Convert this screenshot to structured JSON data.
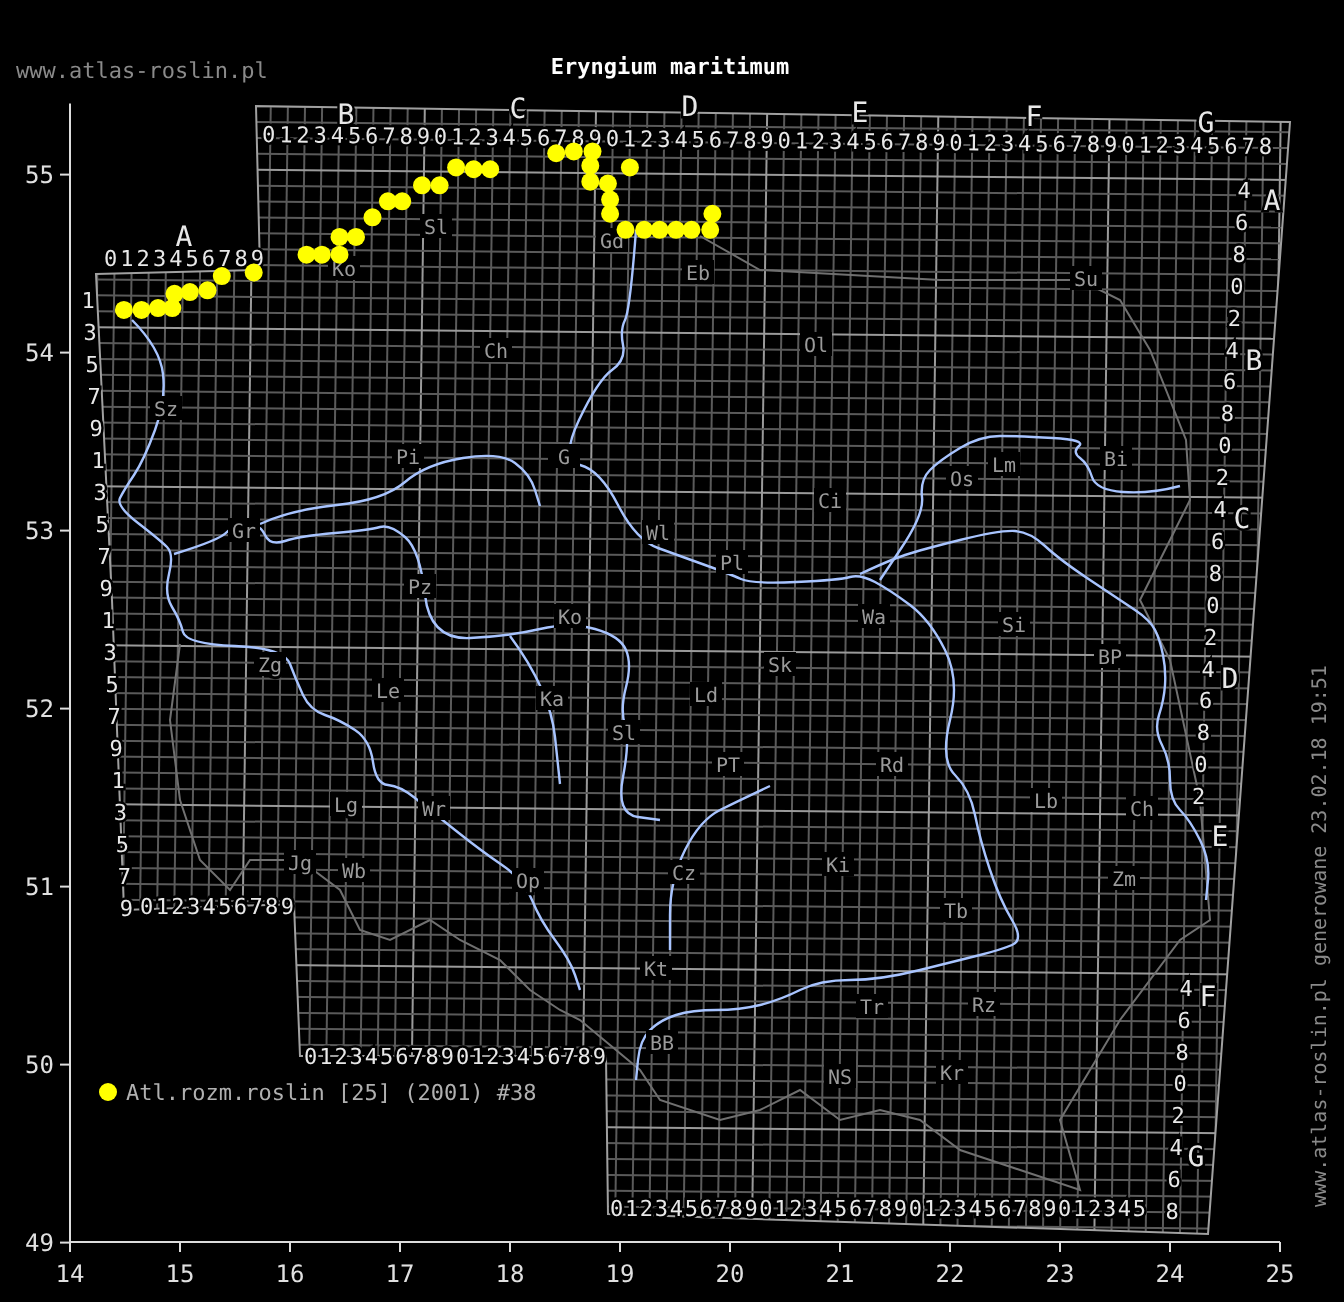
{
  "header": {
    "site": "www.atlas-roslin.pl",
    "title": "Eryngium maritimum"
  },
  "map": {
    "column_letters": [
      "A",
      "B",
      "C",
      "D",
      "E",
      "F",
      "G"
    ],
    "column_digits": [
      "0123456789",
      "01234567890123456789012345678901234567890123456789012345678",
      "0123456789",
      "01234567890123456789",
      "012345678901234567890123456789012345"
    ],
    "left_digits": [
      "1",
      "3",
      "5",
      "7",
      "9",
      "1",
      "3",
      "5",
      "7",
      "9",
      "1",
      "3",
      "5",
      "7",
      "9",
      "1",
      "3",
      "5",
      "7",
      "9"
    ],
    "right_digits": [
      "4",
      "6",
      "8",
      "0",
      "2",
      "4",
      "6",
      "8",
      "0",
      "2",
      "4",
      "6",
      "8",
      "0",
      "2",
      "4",
      "6",
      "8",
      "0",
      "2",
      "4",
      "6",
      "8",
      "0",
      "2",
      "4",
      "6",
      "8"
    ],
    "row_letters": [
      "A",
      "B",
      "C",
      "D",
      "E",
      "F",
      "G"
    ],
    "region_labels": [
      "Sl",
      "Gd",
      "Ko",
      "Eb",
      "Su",
      "Ch",
      "Ol",
      "Sz",
      "Pi",
      "G",
      "Os",
      "Lm",
      "Bi",
      "Ci",
      "Gr",
      "Wl",
      "Pl",
      "Pz",
      "Ko",
      "Wa",
      "Si",
      "Zg",
      "Sk",
      "BP",
      "Le",
      "Ka",
      "Ld",
      "Sl",
      "PT",
      "Rd",
      "Lg",
      "Wr",
      "Lb",
      "Ch",
      "Jg",
      "Wb",
      "Op",
      "Cz",
      "Ki",
      "Zm",
      "Tb",
      "Kt",
      "Tr",
      "Rz",
      "BB",
      "NS",
      "Kr"
    ]
  },
  "chart_data": {
    "type": "scatter",
    "xlim": [
      14,
      25
    ],
    "ylim": [
      49,
      55.4
    ],
    "xticks": [
      14,
      15,
      16,
      17,
      18,
      19,
      20,
      21,
      22,
      23,
      24,
      25
    ],
    "yticks": [
      49,
      50,
      51,
      52,
      53,
      54,
      55
    ],
    "x": [
      14.49,
      14.65,
      14.8,
      14.93,
      14.95,
      15.09,
      15.25,
      15.38,
      15.67,
      16.15,
      16.29,
      16.45,
      16.45,
      16.6,
      16.75,
      16.89,
      17.02,
      17.2,
      17.36,
      17.51,
      17.67,
      17.82,
      18.42,
      18.58,
      18.75,
      18.73,
      19.09,
      18.73,
      18.89,
      18.91,
      18.91,
      19.05,
      19.22,
      19.36,
      19.51,
      19.65,
      19.82,
      19.84
    ],
    "series": [
      {
        "name": "Atl.rozm.roslin [25] (2001) #38",
        "color": "#ffff00",
        "values": [
          54.24,
          54.24,
          54.25,
          54.25,
          54.33,
          54.34,
          54.35,
          54.43,
          54.45,
          54.55,
          54.55,
          54.55,
          54.65,
          54.65,
          54.76,
          54.85,
          54.85,
          54.94,
          54.94,
          55.04,
          55.03,
          55.03,
          55.12,
          55.13,
          55.13,
          55.05,
          55.04,
          54.96,
          54.95,
          54.86,
          54.78,
          54.69,
          54.69,
          54.69,
          54.69,
          54.69,
          54.69,
          54.78
        ]
      }
    ]
  },
  "generated_note": "www.atlas-roslin.pl generowane 23.02.18 19:51"
}
